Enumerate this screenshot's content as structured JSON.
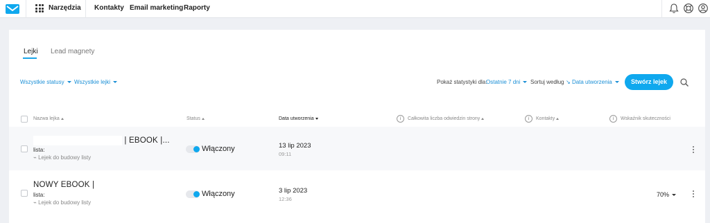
{
  "topnav": {
    "tools_label": "Narzędzia",
    "items": [
      "Kontakty",
      "Email marketing",
      "Raporty"
    ]
  },
  "tabs": [
    {
      "label": "Lejki",
      "active": true
    },
    {
      "label": "Lead magnety",
      "active": false
    }
  ],
  "filters": {
    "statuses": "Wszystkie statusy",
    "funnels": "Wszystkie lejki",
    "stats_label": "Pokaż statystyki dla:",
    "stats_value": "Ostatnie 7 dni",
    "sort_label": "Sortuj według",
    "sort_value": "Data utworzenia"
  },
  "create_button": "Stwórz lejek",
  "columns": {
    "name": "Nazwa lejka",
    "status": "Status",
    "created": "Data utworzenia",
    "visits": "Całkowita liczba odwiedzin strony",
    "contacts": "Kontakty",
    "effectiveness": "Wskaźnik skuteczności"
  },
  "rows": [
    {
      "name": "| EBOOK |...",
      "list": "lista:",
      "type": "Lejek do budowy listy",
      "status": "Włączony",
      "date": "13 lip 2023",
      "time": "09:11",
      "effectiveness": ""
    },
    {
      "name": "NOWY EBOOK |",
      "list": "lista:",
      "type": "Lejek do budowy listy",
      "status": "Włączony",
      "date": "3 lip 2023",
      "time": "12:36",
      "effectiveness": "70%"
    }
  ],
  "colors": {
    "accent": "#0fa8ee",
    "link": "#1a8fd6",
    "background": "#eef0f4"
  },
  "icons": [
    "envelope-logo-icon",
    "apps-grid-icon",
    "bell-icon",
    "help-lifebuoy-icon",
    "user-avatar-icon",
    "search-icon",
    "info-icon",
    "funnel-icon",
    "kebab-menu-icon"
  ]
}
